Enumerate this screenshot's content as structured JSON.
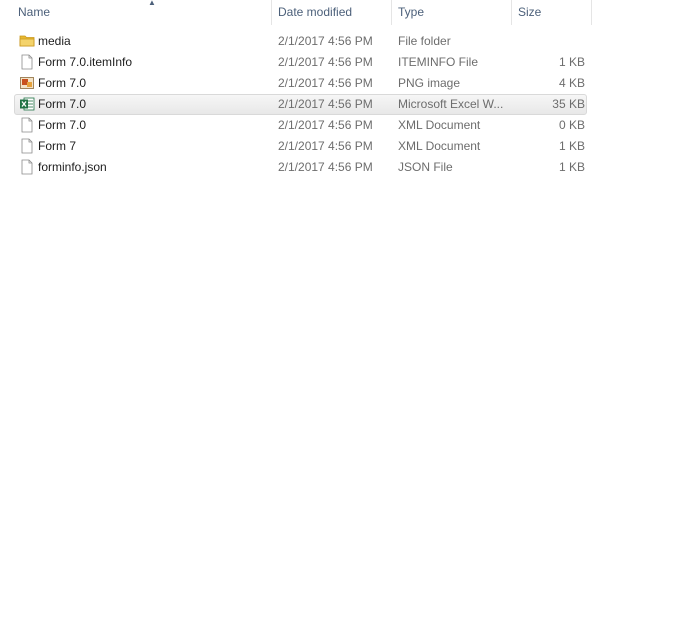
{
  "columns": {
    "name": "Name",
    "date": "Date modified",
    "type": "Type",
    "size": "Size"
  },
  "sort": {
    "column": "name",
    "arrow_icon": "sort-up-arrow-icon"
  },
  "files": [
    {
      "name": "media",
      "date": "2/1/2017 4:56 PM",
      "type": "File folder",
      "size": "",
      "icon": "folder-icon"
    },
    {
      "name": "Form 7.0.itemInfo",
      "date": "2/1/2017 4:56 PM",
      "type": "ITEMINFO File",
      "size": "1 KB",
      "icon": "blank-document-icon"
    },
    {
      "name": "Form 7.0",
      "date": "2/1/2017 4:56 PM",
      "type": "PNG image",
      "size": "4 KB",
      "icon": "image-file-icon"
    },
    {
      "name": "Form 7.0",
      "date": "2/1/2017 4:56 PM",
      "type": "Microsoft Excel W...",
      "size": "35 KB",
      "icon": "excel-file-icon",
      "selected": true
    },
    {
      "name": "Form 7.0",
      "date": "2/1/2017 4:56 PM",
      "type": "XML Document",
      "size": "0 KB",
      "icon": "blank-document-icon"
    },
    {
      "name": "Form 7",
      "date": "2/1/2017 4:56 PM",
      "type": "XML Document",
      "size": "1 KB",
      "icon": "blank-document-icon"
    },
    {
      "name": "forminfo.json",
      "date": "2/1/2017 4:56 PM",
      "type": "JSON File",
      "size": "1 KB",
      "icon": "blank-document-icon"
    }
  ],
  "colors": {
    "header_text": "#4c607a",
    "selection_border": "#d9d9d9",
    "folder_yellow": "#e8b830",
    "excel_green": "#1f7244",
    "png_orange": "#c8501e"
  }
}
